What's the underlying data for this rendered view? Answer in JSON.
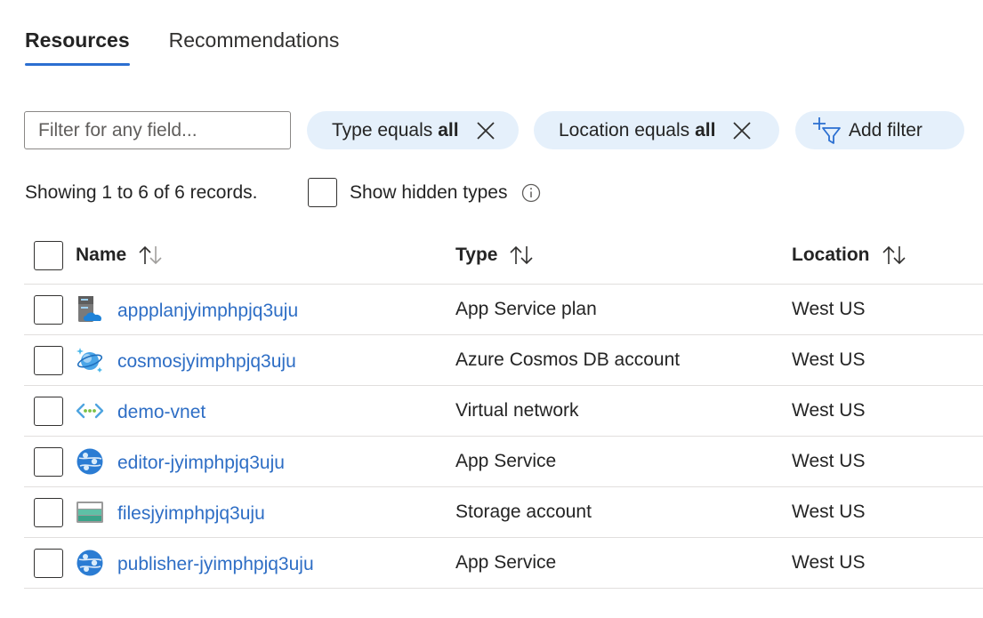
{
  "tabs": [
    {
      "label": "Resources",
      "active": true
    },
    {
      "label": "Recommendations",
      "active": false
    }
  ],
  "filter": {
    "placeholder": "Filter for any field...",
    "value": ""
  },
  "pills": {
    "type": {
      "prefix": "Type equals",
      "value": "all"
    },
    "location": {
      "prefix": "Location equals",
      "value": "all"
    },
    "add": {
      "label": "Add filter"
    }
  },
  "records_text": "Showing 1 to 6 of 6 records.",
  "show_hidden_label": "Show hidden types",
  "columns": {
    "name": "Name",
    "type": "Type",
    "location": "Location"
  },
  "rows": [
    {
      "name": "appplanjyimphpjq3uju",
      "type": "App Service plan",
      "location": "West US",
      "icon": "app-service-plan-icon"
    },
    {
      "name": "cosmosjyimphpjq3uju",
      "type": "Azure Cosmos DB account",
      "location": "West US",
      "icon": "cosmos-db-icon"
    },
    {
      "name": "demo-vnet",
      "type": "Virtual network",
      "location": "West US",
      "icon": "virtual-network-icon"
    },
    {
      "name": "editor-jyimphpjq3uju",
      "type": "App Service",
      "location": "West US",
      "icon": "app-service-icon"
    },
    {
      "name": "filesjyimphpjq3uju",
      "type": "Storage account",
      "location": "West US",
      "icon": "storage-account-icon"
    },
    {
      "name": "publisher-jyimphpjq3uju",
      "type": "App Service",
      "location": "West US",
      "icon": "app-service-icon"
    }
  ],
  "colors": {
    "accent": "#2b6fd1",
    "link": "#2e6ec5",
    "pill_bg": "#e5f0fb"
  }
}
